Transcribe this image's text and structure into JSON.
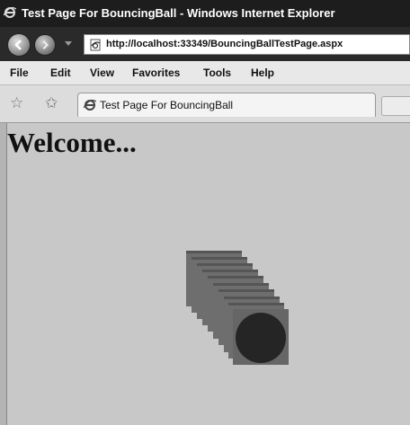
{
  "window": {
    "title": "Test Page For BouncingBall - Windows Internet Explorer"
  },
  "address": {
    "url": "http://localhost:33349/BouncingBallTestPage.aspx"
  },
  "menu": {
    "items": [
      "File",
      "Edit",
      "View",
      "Favorites",
      "Tools",
      "Help"
    ]
  },
  "tab": {
    "label": "Test Page For BouncingBall"
  },
  "page": {
    "heading": "Welcome..."
  },
  "icons": [
    "ie-icon",
    "back-arrow-icon",
    "forward-arrow-icon",
    "page-icon",
    "favorites-star-icon",
    "add-favorites-icon"
  ]
}
